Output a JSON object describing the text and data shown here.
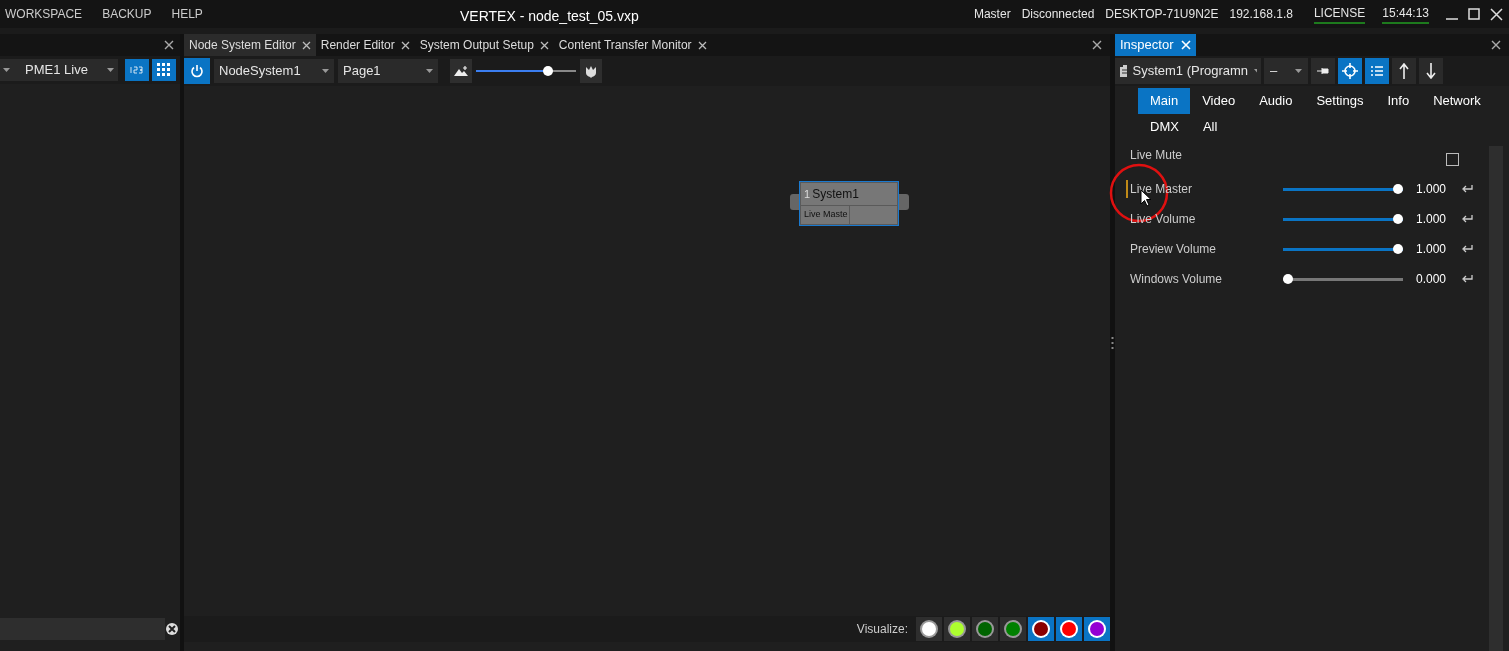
{
  "menu": [
    "WORKSPACE",
    "BACKUP",
    "HELP"
  ],
  "window": {
    "title": "VERTEX - node_test_05.vxp"
  },
  "status": {
    "role": "Master",
    "connection": "Disconnected",
    "host": "DESKTOP-71U9N2E",
    "ip": "192.168.1.8",
    "license": "LICENSE",
    "time": "15:44:13"
  },
  "left_panel": {
    "dropdown": "PME1 Live"
  },
  "editor_tabs": [
    {
      "label": "Node System Editor",
      "selected": true
    },
    {
      "label": "Render Editor",
      "selected": false
    },
    {
      "label": "System Output Setup",
      "selected": false
    },
    {
      "label": "Content Transfer Monitor",
      "selected": false
    }
  ],
  "editor_toolbar": {
    "system": "NodeSystem1",
    "page": "Page1",
    "zoom": {
      "level": 0.72
    }
  },
  "node": {
    "index": "1",
    "title": "System1",
    "port": "Live Maste"
  },
  "visualize": {
    "label": "Visualize:",
    "buttons": [
      {
        "color": "#ffffff",
        "selected": false
      },
      {
        "color": "#adff2f",
        "selected": false
      },
      {
        "color": "#006400",
        "selected": false
      },
      {
        "color": "#008000",
        "selected": false
      },
      {
        "color": "#8b0000",
        "selected": true
      },
      {
        "color": "#ff0000",
        "selected": true
      },
      {
        "color": "#9400d3",
        "selected": true
      }
    ]
  },
  "inspector": {
    "title": "Inspector",
    "object": "System1 (Programn",
    "dropdown": "–",
    "tabs": [
      {
        "label": "Main",
        "selected": true
      },
      {
        "label": "Video",
        "selected": false
      },
      {
        "label": "Audio",
        "selected": false
      },
      {
        "label": "Settings",
        "selected": false
      },
      {
        "label": "Info",
        "selected": false
      },
      {
        "label": "Network",
        "selected": false
      },
      {
        "label": "DMX",
        "selected": false
      },
      {
        "label": "All",
        "selected": false
      }
    ],
    "properties": [
      {
        "kind": "checkbox",
        "label": "Live Mute",
        "checked": false
      },
      {
        "kind": "slider",
        "label": "Live Master",
        "level": 1,
        "reading": "1.000",
        "focused": true
      },
      {
        "kind": "slider",
        "label": "Live Volume",
        "level": 1,
        "reading": "1.000",
        "focused": false
      },
      {
        "kind": "slider",
        "label": "Preview Volume",
        "level": 1,
        "reading": "1.000",
        "focused": false
      },
      {
        "kind": "slider",
        "label": "Windows Volume",
        "level": 0,
        "reading": "0.000",
        "focused": false
      }
    ]
  }
}
